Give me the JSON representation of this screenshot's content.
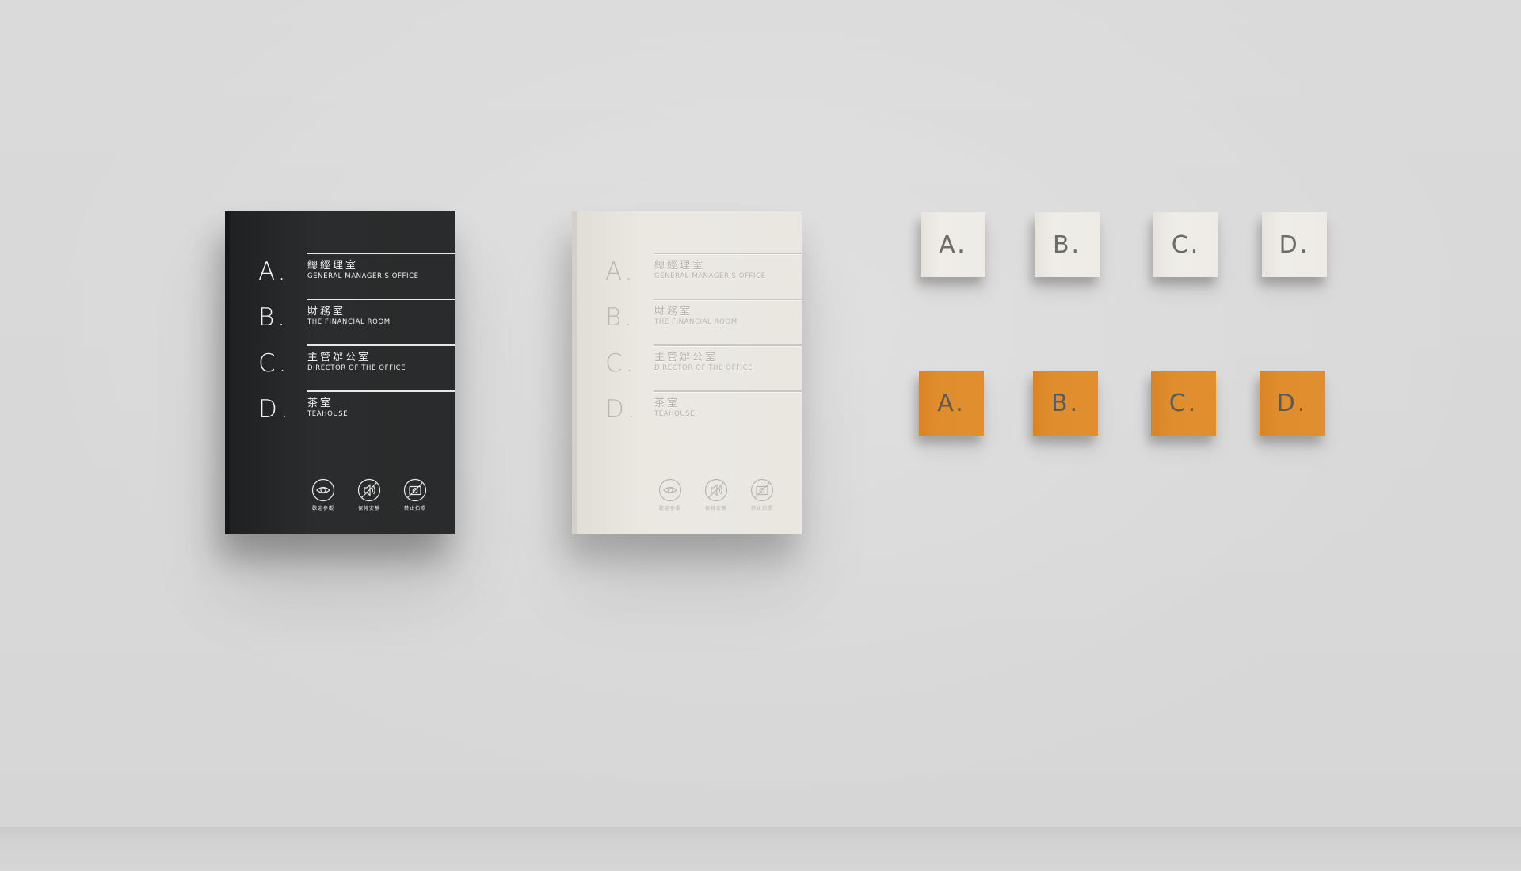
{
  "scene": {
    "wall_color": "#d9d9d9",
    "floor_color": "#cfcfcf"
  },
  "dark_board": {
    "color": "#2a2b2c",
    "entries": [
      {
        "letter": "A.",
        "zh": "總經理室",
        "en": "GENERAL MANAGER'S OFFICE"
      },
      {
        "letter": "B.",
        "zh": "財務室",
        "en": "THE FINANCIAL ROOM"
      },
      {
        "letter": "C.",
        "zh": "主管辦公室",
        "en": "DIRECTOR OF THE OFFICE"
      },
      {
        "letter": "D.",
        "zh": "茶室",
        "en": "TEAHOUSE"
      }
    ],
    "icons": [
      {
        "name": "eye-icon",
        "caption": "歡迎參觀"
      },
      {
        "name": "speaker-icon",
        "caption": "保持安靜"
      },
      {
        "name": "no-photo-icon",
        "caption": "禁止拍照"
      }
    ]
  },
  "light_board": {
    "color": "#eae7e1",
    "entries": [
      {
        "letter": "A.",
        "zh": "總經理室",
        "en": "GENERAL MANAGER'S OFFICE"
      },
      {
        "letter": "B.",
        "zh": "財務室",
        "en": "THE FINANCIAL ROOM"
      },
      {
        "letter": "C.",
        "zh": "主管辦公室",
        "en": "DIRECTOR OF THE OFFICE"
      },
      {
        "letter": "D.",
        "zh": "茶室",
        "en": "TEAHOUSE"
      }
    ],
    "icons": [
      {
        "name": "eye-icon",
        "caption": "歡迎參觀"
      },
      {
        "name": "speaker-icon",
        "caption": "保持安靜"
      },
      {
        "name": "no-photo-icon",
        "caption": "禁止拍照"
      }
    ]
  },
  "tiles_white": {
    "color": "#eeebe6",
    "labels": [
      "A.",
      "B.",
      "C.",
      "D."
    ]
  },
  "tiles_orange": {
    "color": "#e08d2d",
    "labels": [
      "A.",
      "B.",
      "C.",
      "D."
    ]
  }
}
